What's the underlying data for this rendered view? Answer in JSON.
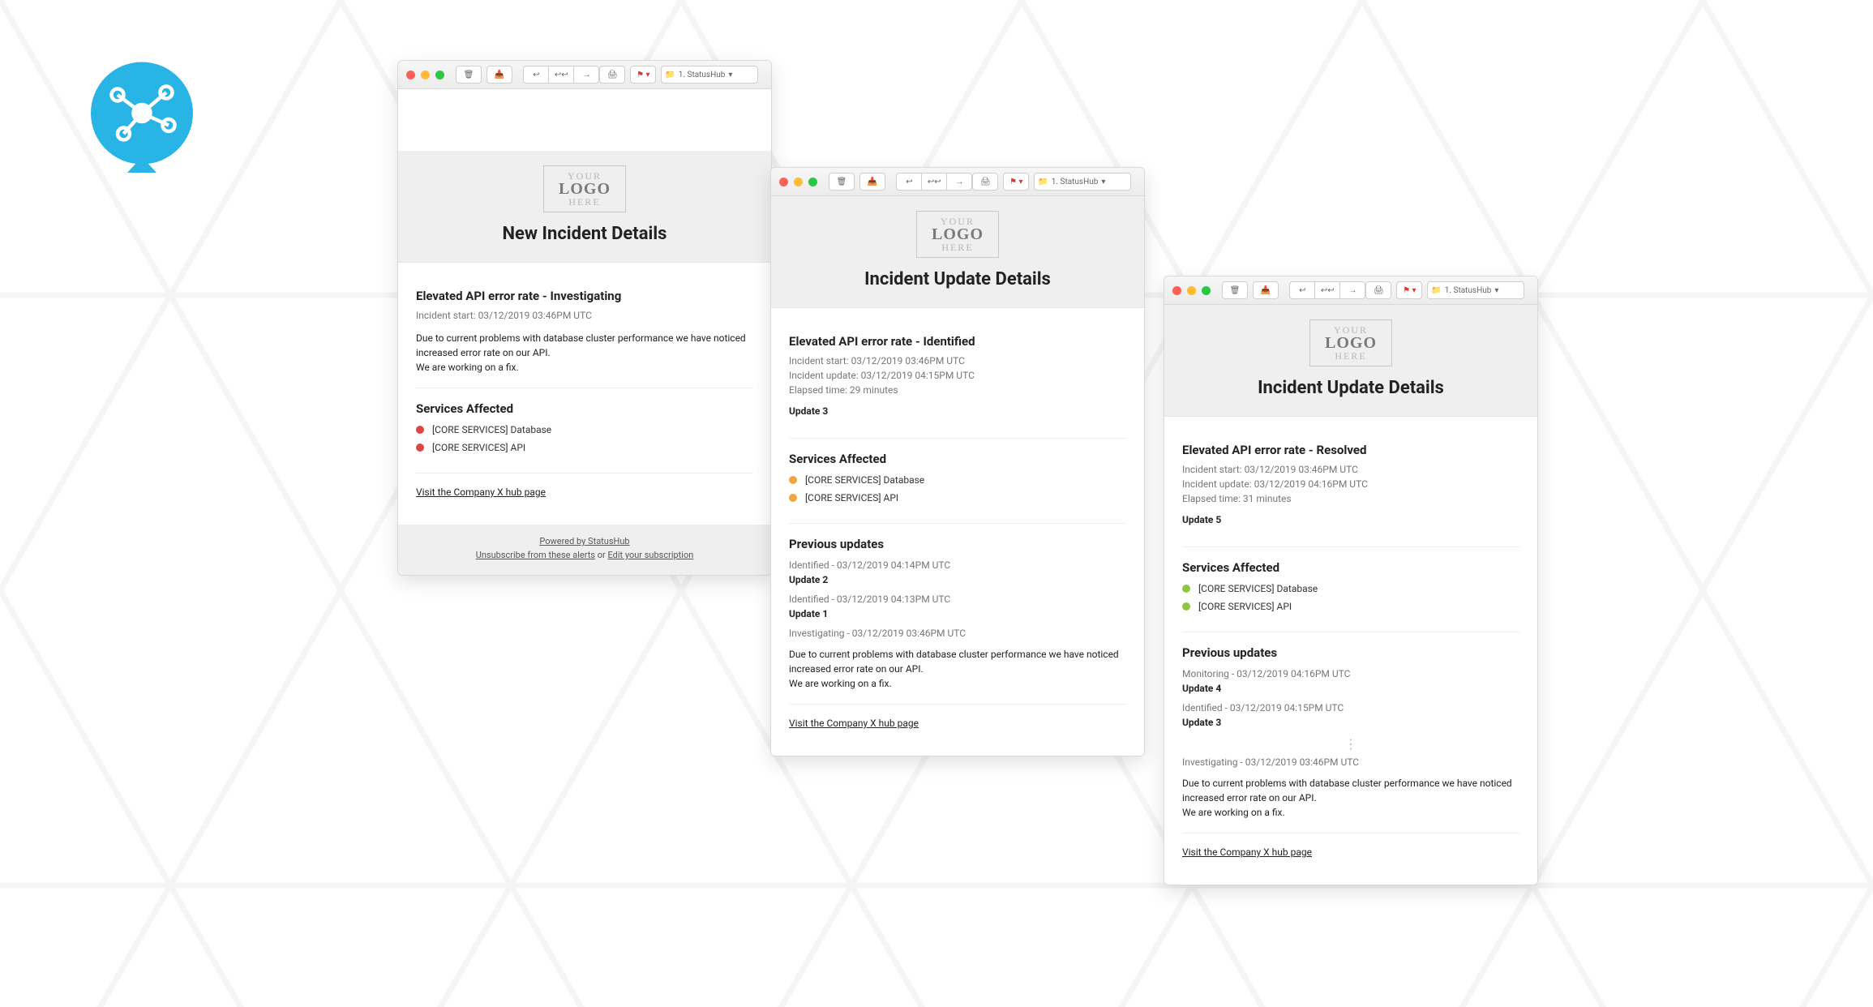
{
  "brand_accent": "#28b4e4",
  "logo_placeholder": {
    "line1": "YOUR",
    "line2": "LOGO",
    "line3": "HERE"
  },
  "toolbar": {
    "mailbox_label": "1. StatusHub",
    "trash": "trash-icon",
    "archive": "archive-icon",
    "reply": "reply-icon",
    "reply_all": "reply-all-icon",
    "forward": "forward-icon",
    "print": "print-icon",
    "flag": "flag-icon",
    "folder": "folder-icon"
  },
  "footer": {
    "powered": "Powered by StatusHub",
    "unsubscribe": "Unsubscribe from these alerts",
    "or": " or ",
    "edit": "Edit your subscription"
  },
  "hub_link": "Visit the Company X hub page",
  "windows": [
    {
      "id": "win1",
      "heading": "New Incident Details",
      "subtitle": "Elevated API error rate - Investigating",
      "meta": [
        "Incident start: 03/12/2019 03:46PM UTC"
      ],
      "description": "Due to current problems with database cluster performance we have noticed increased error rate on our API.\nWe are working on a fix.",
      "services_title": "Services Affected",
      "service_color": "b-red",
      "services": [
        "[CORE SERVICES] Database",
        "[CORE SERVICES] API"
      ],
      "show_footer": true
    },
    {
      "id": "win2",
      "heading": "Incident Update Details",
      "subtitle": "Elevated API error rate - Identified",
      "meta": [
        "Incident start: 03/12/2019 03:46PM UTC",
        "Incident update: 03/12/2019 04:15PM UTC",
        "Elapsed time: 29 minutes"
      ],
      "current_update": "Update 3",
      "services_title": "Services Affected",
      "service_color": "b-orange",
      "services": [
        "[CORE SERVICES] Database",
        "[CORE SERVICES] API"
      ],
      "previous_title": "Previous updates",
      "previous": [
        {
          "line": "Identified - 03/12/2019 04:14PM UTC",
          "title": "Update 2"
        },
        {
          "line": "Identified - 03/12/2019 04:13PM UTC",
          "title": "Update 1"
        },
        {
          "line": "Investigating - 03/12/2019 03:46PM UTC"
        }
      ],
      "description": "Due to current problems with database cluster performance we have noticed increased error rate on our API.\nWe are working on a fix.",
      "show_footer": false
    },
    {
      "id": "win3",
      "heading": "Incident Update Details",
      "subtitle": "Elevated API error rate - Resolved",
      "meta": [
        "Incident start: 03/12/2019 03:46PM UTC",
        "Incident update: 03/12/2019 04:16PM UTC",
        "Elapsed time: 31 minutes"
      ],
      "current_update": "Update 5",
      "services_title": "Services Affected",
      "service_color": "b-green",
      "services": [
        "[CORE SERVICES] Database",
        "[CORE SERVICES] API"
      ],
      "previous_title": "Previous updates",
      "previous": [
        {
          "line": "Monitoring - 03/12/2019 04:16PM UTC",
          "title": "Update 4"
        },
        {
          "line": "Identified - 03/12/2019 04:15PM UTC",
          "title": "Update 3"
        }
      ],
      "ellipsis": true,
      "tail_line": "Investigating - 03/12/2019 03:46PM UTC",
      "description": "Due to current problems with database cluster performance we have noticed increased error rate on our API.\nWe are working on a fix.",
      "show_footer": false
    }
  ]
}
